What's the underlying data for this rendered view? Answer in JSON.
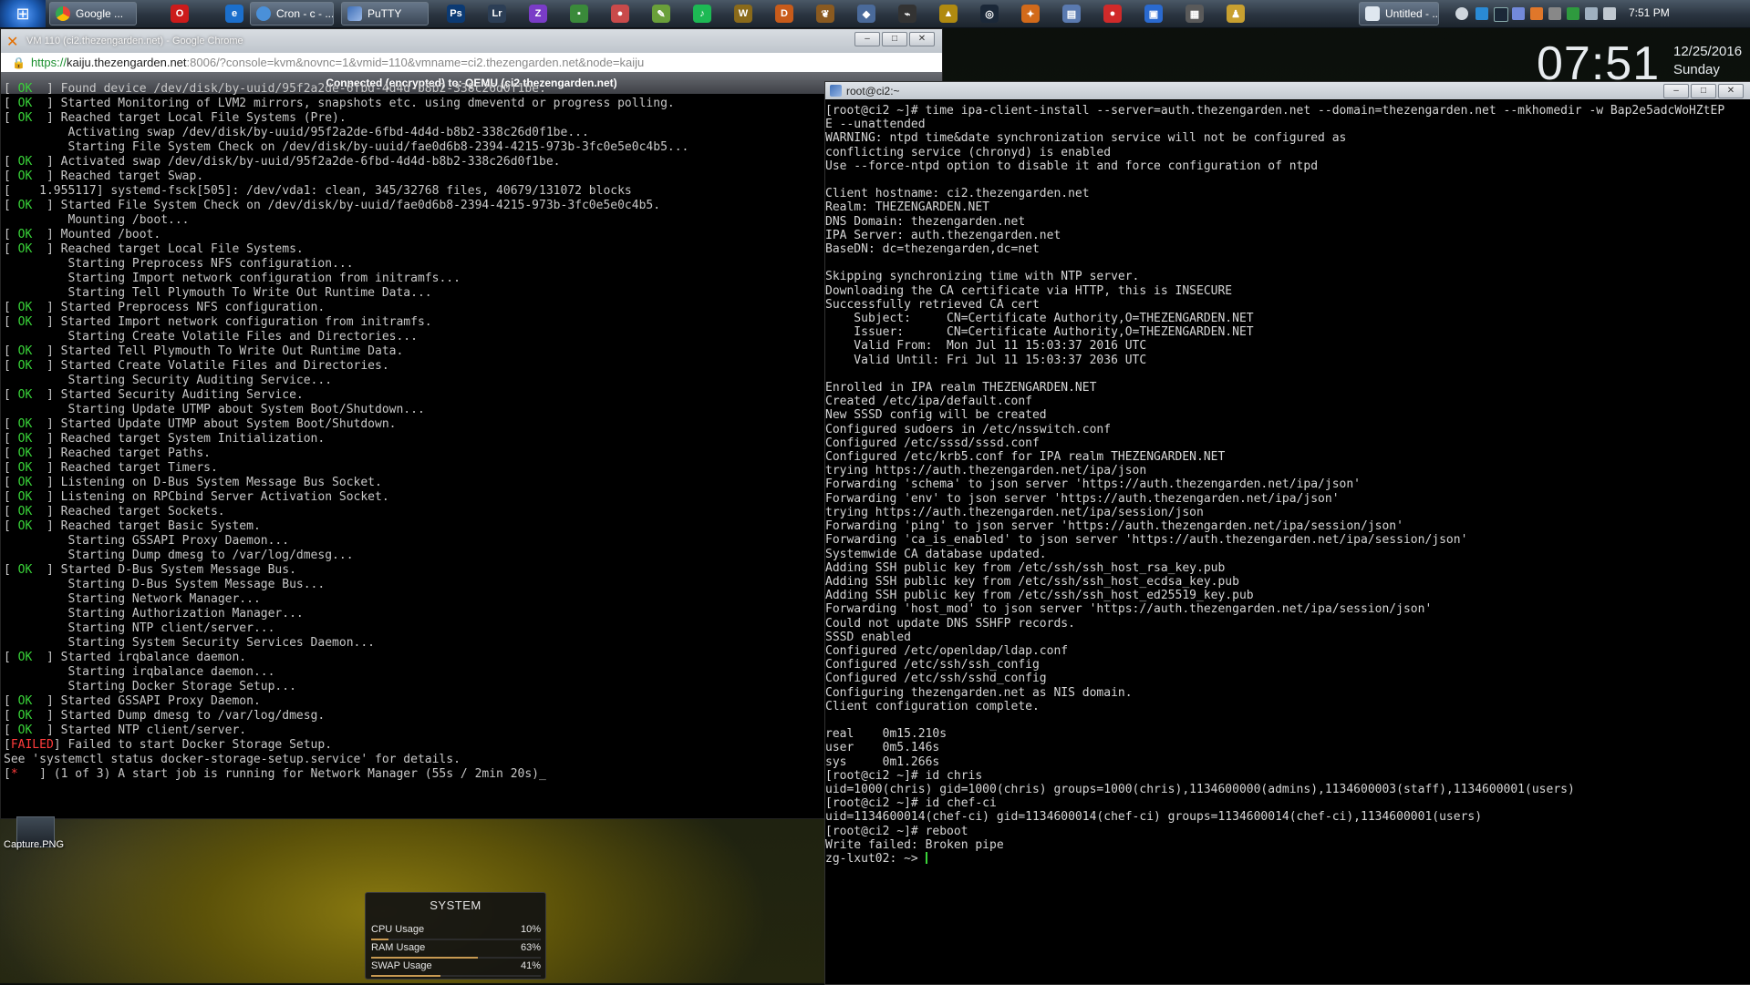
{
  "taskbar": {
    "buttons": [
      {
        "label": "Google ...",
        "color": "#ea4335"
      },
      {
        "label": "Cron - c - ...",
        "color": "#4a90d9"
      },
      {
        "label": "PuTTY",
        "color": "#6f8fbf"
      }
    ],
    "untitled_label": "Untitled - ...",
    "quick_icons": [
      {
        "name": "opera-icon",
        "glyph": "O",
        "color": "#cc1b1b"
      },
      {
        "name": "ie-icon",
        "glyph": "e",
        "color": "#1b6fcc"
      },
      {
        "name": "photoshop-icon",
        "glyph": "Ps",
        "color": "#0b3a73"
      },
      {
        "name": "lightroom-icon",
        "glyph": "Lr",
        "color": "#2c3e55"
      },
      {
        "name": "zotero-icon",
        "glyph": "Z",
        "color": "#7a3cc7"
      },
      {
        "name": "app-green-icon",
        "glyph": "▪",
        "color": "#3a8a3a"
      },
      {
        "name": "app-red-icon",
        "glyph": "●",
        "color": "#c94a4a"
      },
      {
        "name": "notes-icon",
        "glyph": "✎",
        "color": "#6aa03a"
      },
      {
        "name": "spotify-icon",
        "glyph": "♪",
        "color": "#1db954"
      },
      {
        "name": "wow-icon",
        "glyph": "W",
        "color": "#8a6a1a"
      },
      {
        "name": "app-orange-icon",
        "glyph": "D",
        "color": "#c85b1a"
      },
      {
        "name": "app-leaf-icon",
        "glyph": "❦",
        "color": "#8a5a20"
      },
      {
        "name": "cube-icon",
        "glyph": "◆",
        "color": "#4a6a9a"
      },
      {
        "name": "app-dark-icon",
        "glyph": "⌁",
        "color": "#333333"
      },
      {
        "name": "app-yellow-icon",
        "glyph": "▲",
        "color": "#b08a10"
      },
      {
        "name": "steam-icon",
        "glyph": "◎",
        "color": "#1b2838"
      },
      {
        "name": "app-orange2-icon",
        "glyph": "✦",
        "color": "#d26a1a"
      },
      {
        "name": "folder-icon",
        "glyph": "▤",
        "color": "#5a7ab0"
      },
      {
        "name": "app-red2-icon",
        "glyph": "●",
        "color": "#d02a2a"
      },
      {
        "name": "app-blue-icon",
        "glyph": "▣",
        "color": "#2a6ad0"
      },
      {
        "name": "calculator-icon",
        "glyph": "▦",
        "color": "#5a5a5a"
      },
      {
        "name": "user-icon",
        "glyph": "♟",
        "color": "#c8a030"
      }
    ],
    "clock": "7:51 PM"
  },
  "desktop": {
    "time": "07:51",
    "date": "12/25/2016",
    "day": "Sunday",
    "capture_label": "Capture.PNG"
  },
  "chrome": {
    "title": "VM 110 (ci2.thezengarden.net) - Google Chrome",
    "url_proto": "https://",
    "url_host": "kaiju.thezengarden.net",
    "url_path": ":8006/?console=kvm&novnc=1&vmid=110&vmname=ci2.thezengarden.net&node=kaiju",
    "novnc_status": "Connected (encrypted) to: QEMU (ci2.thezengarden.net)"
  },
  "console_lines": [
    {
      "s": "ok",
      "t": "Found device /dev/disk/by-uuid/95f2a2de-6fbd-4d4d-b8b2-338c26d0f1be."
    },
    {
      "s": "ok",
      "t": "Started Monitoring of LVM2 mirrors, snapshots etc. using dmeventd or progress polling."
    },
    {
      "s": "ok",
      "t": "Reached target Local File Systems (Pre)."
    },
    {
      "s": "",
      "t": "Activating swap /dev/disk/by-uuid/95f2a2de-6fbd-4d4d-b8b2-338c26d0f1be..."
    },
    {
      "s": "",
      "t": "Starting File System Check on /dev/disk/by-uuid/fae0d6b8-2394-4215-973b-3fc0e5e0c4b5..."
    },
    {
      "s": "ok",
      "t": "Activated swap /dev/disk/by-uuid/95f2a2de-6fbd-4d4d-b8b2-338c26d0f1be."
    },
    {
      "s": "ok",
      "t": "Reached target Swap."
    },
    {
      "s": "raw",
      "t": "[    1.955117] systemd-fsck[505]: /dev/vda1: clean, 345/32768 files, 40679/131072 blocks"
    },
    {
      "s": "ok",
      "t": "Started File System Check on /dev/disk/by-uuid/fae0d6b8-2394-4215-973b-3fc0e5e0c4b5."
    },
    {
      "s": "",
      "t": "Mounting /boot..."
    },
    {
      "s": "ok",
      "t": "Mounted /boot."
    },
    {
      "s": "ok",
      "t": "Reached target Local File Systems."
    },
    {
      "s": "",
      "t": "Starting Preprocess NFS configuration..."
    },
    {
      "s": "",
      "t": "Starting Import network configuration from initramfs..."
    },
    {
      "s": "",
      "t": "Starting Tell Plymouth To Write Out Runtime Data..."
    },
    {
      "s": "ok",
      "t": "Started Preprocess NFS configuration."
    },
    {
      "s": "ok",
      "t": "Started Import network configuration from initramfs."
    },
    {
      "s": "",
      "t": "Starting Create Volatile Files and Directories..."
    },
    {
      "s": "ok",
      "t": "Started Tell Plymouth To Write Out Runtime Data."
    },
    {
      "s": "ok",
      "t": "Started Create Volatile Files and Directories."
    },
    {
      "s": "",
      "t": "Starting Security Auditing Service..."
    },
    {
      "s": "ok",
      "t": "Started Security Auditing Service."
    },
    {
      "s": "",
      "t": "Starting Update UTMP about System Boot/Shutdown..."
    },
    {
      "s": "ok",
      "t": "Started Update UTMP about System Boot/Shutdown."
    },
    {
      "s": "ok",
      "t": "Reached target System Initialization."
    },
    {
      "s": "ok",
      "t": "Reached target Paths."
    },
    {
      "s": "ok",
      "t": "Reached target Timers."
    },
    {
      "s": "ok",
      "t": "Listening on D-Bus System Message Bus Socket."
    },
    {
      "s": "ok",
      "t": "Listening on RPCbind Server Activation Socket."
    },
    {
      "s": "ok",
      "t": "Reached target Sockets."
    },
    {
      "s": "ok",
      "t": "Reached target Basic System."
    },
    {
      "s": "",
      "t": "Starting GSSAPI Proxy Daemon..."
    },
    {
      "s": "",
      "t": "Starting Dump dmesg to /var/log/dmesg..."
    },
    {
      "s": "ok",
      "t": "Started D-Bus System Message Bus."
    },
    {
      "s": "",
      "t": "Starting D-Bus System Message Bus..."
    },
    {
      "s": "",
      "t": "Starting Network Manager..."
    },
    {
      "s": "",
      "t": "Starting Authorization Manager..."
    },
    {
      "s": "",
      "t": "Starting NTP client/server..."
    },
    {
      "s": "",
      "t": "Starting System Security Services Daemon..."
    },
    {
      "s": "ok",
      "t": "Started irqbalance daemon."
    },
    {
      "s": "",
      "t": "Starting irqbalance daemon..."
    },
    {
      "s": "",
      "t": "Starting Docker Storage Setup..."
    },
    {
      "s": "ok",
      "t": "Started GSSAPI Proxy Daemon."
    },
    {
      "s": "ok",
      "t": "Started Dump dmesg to /var/log/dmesg."
    },
    {
      "s": "ok",
      "t": "Started NTP client/server."
    },
    {
      "s": "failed",
      "t": "Failed to start Docker Storage Setup."
    },
    {
      "s": "raw",
      "t": "See 'systemctl status docker-storage-setup.service' for details."
    },
    {
      "s": "star",
      "t": "(1 of 3) A start job is running for Network Manager (55s / 2min 20s)_"
    }
  ],
  "console_tags": {
    "ok": " OK ",
    "failed": "FAILED",
    "star": "*  "
  },
  "putty": {
    "title": "root@ci2:~",
    "lines": [
      "[root@ci2 ~]# time ipa-client-install --server=auth.thezengarden.net --domain=thezengarden.net --mkhomedir -w Bap2e5adcWoHZtEP",
      "E --unattended",
      "WARNING: ntpd time&date synchronization service will not be configured as",
      "conflicting service (chronyd) is enabled",
      "Use --force-ntpd option to disable it and force configuration of ntpd",
      "",
      "Client hostname: ci2.thezengarden.net",
      "Realm: THEZENGARDEN.NET",
      "DNS Domain: thezengarden.net",
      "IPA Server: auth.thezengarden.net",
      "BaseDN: dc=thezengarden,dc=net",
      "",
      "Skipping synchronizing time with NTP server.",
      "Downloading the CA certificate via HTTP, this is INSECURE",
      "Successfully retrieved CA cert",
      "    Subject:     CN=Certificate Authority,O=THEZENGARDEN.NET",
      "    Issuer:      CN=Certificate Authority,O=THEZENGARDEN.NET",
      "    Valid From:  Mon Jul 11 15:03:37 2016 UTC",
      "    Valid Until: Fri Jul 11 15:03:37 2036 UTC",
      "",
      "Enrolled in IPA realm THEZENGARDEN.NET",
      "Created /etc/ipa/default.conf",
      "New SSSD config will be created",
      "Configured sudoers in /etc/nsswitch.conf",
      "Configured /etc/sssd/sssd.conf",
      "Configured /etc/krb5.conf for IPA realm THEZENGARDEN.NET",
      "trying https://auth.thezengarden.net/ipa/json",
      "Forwarding 'schema' to json server 'https://auth.thezengarden.net/ipa/json'",
      "Forwarding 'env' to json server 'https://auth.thezengarden.net/ipa/json'",
      "trying https://auth.thezengarden.net/ipa/session/json",
      "Forwarding 'ping' to json server 'https://auth.thezengarden.net/ipa/session/json'",
      "Forwarding 'ca_is_enabled' to json server 'https://auth.thezengarden.net/ipa/session/json'",
      "Systemwide CA database updated.",
      "Adding SSH public key from /etc/ssh/ssh_host_rsa_key.pub",
      "Adding SSH public key from /etc/ssh/ssh_host_ecdsa_key.pub",
      "Adding SSH public key from /etc/ssh/ssh_host_ed25519_key.pub",
      "Forwarding 'host_mod' to json server 'https://auth.thezengarden.net/ipa/session/json'",
      "Could not update DNS SSHFP records.",
      "SSSD enabled",
      "Configured /etc/openldap/ldap.conf",
      "Configured /etc/ssh/ssh_config",
      "Configured /etc/ssh/sshd_config",
      "Configuring thezengarden.net as NIS domain.",
      "Client configuration complete.",
      "",
      "real    0m15.210s",
      "user    0m5.146s",
      "sys     0m1.266s",
      "[root@ci2 ~]# id chris",
      "uid=1000(chris) gid=1000(chris) groups=1000(chris),1134600000(admins),1134600003(staff),1134600001(users)",
      "[root@ci2 ~]# id chef-ci",
      "uid=1134600014(chef-ci) gid=1134600014(chef-ci) groups=1134600014(chef-ci),1134600001(users)",
      "[root@ci2 ~]# reboot",
      "Write failed: Broken pipe"
    ],
    "prompt": "zg-lxut02: ~> "
  },
  "system_gadget": {
    "title": "SYSTEM",
    "rows": [
      {
        "label": "CPU Usage",
        "value": "10%",
        "fraction": 0.1
      },
      {
        "label": "RAM Usage",
        "value": "63%",
        "fraction": 0.63
      },
      {
        "label": "SWAP Usage",
        "value": "41%",
        "fraction": 0.41
      }
    ]
  }
}
